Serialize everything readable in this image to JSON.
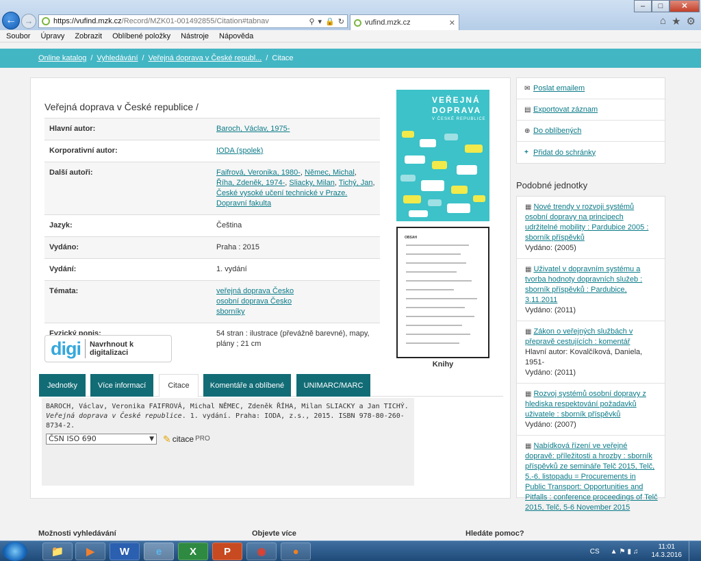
{
  "browser": {
    "url_host": "https://vufind.mzk.cz",
    "url_path": "/Record/MZK01-001492855/Citation#tabnav",
    "tab_title": "vufind.mzk.cz",
    "menu": [
      "Soubor",
      "Úpravy",
      "Zobrazit",
      "Oblíbené položky",
      "Nástroje",
      "Nápověda"
    ]
  },
  "breadcrumb": {
    "items": [
      "Online katalog",
      "Vyhledávání",
      "Veřejná doprava v České republ...",
      "Citace"
    ]
  },
  "record": {
    "title": "Veřejná doprava v České republice /",
    "rows": [
      {
        "label": "Hlavní autor:",
        "values": [
          "Baroch, Václav, 1975-"
        ]
      },
      {
        "label": "Korporativní autor:",
        "values": [
          "IODA (spolek)"
        ]
      },
      {
        "label": "Další autoři:",
        "values": [
          "Faifrová, Veronika, 1980-",
          "Němec, Michal",
          "Říha, Zdeněk, 1974-",
          "Sliacky, Milan",
          "Tichý, Jan",
          "České vysoké učení technické v Praze. Dopravní fakulta"
        ]
      },
      {
        "label": "Jazyk:",
        "values": [
          "Čeština"
        ]
      },
      {
        "label": "Vydáno:",
        "values": [
          "Praha : 2015"
        ]
      },
      {
        "label": "Vydání:",
        "values": [
          "1. vydání"
        ]
      },
      {
        "label": "Témata:",
        "values": [
          "veřejná doprava Česko",
          "osobní doprava Česko",
          "sborníky"
        ]
      },
      {
        "label": "Fyzický popis:",
        "values": [
          "54 stran : ilustrace (převážně barevné), mapy, plány ; 21 cm"
        ]
      }
    ],
    "digi": {
      "logo": "digi",
      "label": "Navrhnout k digitalizaci"
    },
    "cover": {
      "title_lines": [
        "VEŘEJNÁ",
        "DOPRAVA"
      ],
      "subtitle": "V ČESKÉ REPUBLICE",
      "toc_heading": "OBSAH",
      "caption": "Knihy"
    }
  },
  "tabs": [
    "Jednotky",
    "Více informací",
    "Citace",
    "Komentáře a oblíbené",
    "UNIMARC/MARC"
  ],
  "active_tab": "Citace",
  "citation": {
    "authors": "BAROCH, Václav, Veronika FAIFROVÁ, Michal NĚMEC, Zdeněk ŘÍHA, Milan SLIACKY a Jan TICHÝ.",
    "title": "Veřejná doprava v České republice",
    "rest": ". 1. vydání. Praha: IODA, z.s., 2015. ISBN 978-80-260-8734-2.",
    "style_selected": "ČSN ISO 690",
    "citace_pro_label": "citace",
    "citace_pro_suffix": "PRO"
  },
  "actions": [
    "Poslat emailem",
    "Exportovat záznam",
    "Do oblíbených",
    "Přidat do schránky"
  ],
  "similar": {
    "heading": "Podobné jednotky",
    "items": [
      {
        "title": "Nové trendy v rozvoji systémů osobní dopravy na principech udržitelné mobility : Pardubice 2005 : sborník příspěvků",
        "meta": [
          "Vydáno: (2005)"
        ]
      },
      {
        "title": "Uživatel v dopravním systému a tvorba hodnoty dopravních služeb : sborník příspěvků : Pardubice, 3.11.2011",
        "meta": [
          "Vydáno: (2011)"
        ]
      },
      {
        "title": "Zákon o veřejných službách v přepravě cestujících : komentář",
        "meta": [
          "Hlavní autor: Kovalčíková, Daniela, 1951-",
          "Vydáno: (2011)"
        ]
      },
      {
        "title": "Rozvoj systémů osobní dopravy z hlediska respektování požadavků uživatele : sborník příspěvků",
        "meta": [
          "Vydáno: (2007)"
        ]
      },
      {
        "title": "Nabídková řízení ve veřejné dopravě: příležitosti a hrozby : sborník příspěvků ze semináře Telč 2015, Telč, 5.-6. listopadu = Procurements in Public Transport: Opportunities and Pitfalls : conference proceedings of Telč 2015, Telč, 5-6 November 2015",
        "meta": []
      }
    ]
  },
  "footer": [
    "Možnosti vyhledávání",
    "Objevte více",
    "Hledáte pomoc?"
  ],
  "taskbar": {
    "lang": "CS",
    "time": "11:01",
    "date": "14.3.2016"
  },
  "colors": {
    "accent": "#43b6c4",
    "tab_dark": "#126c76",
    "link": "#0a7a88"
  }
}
